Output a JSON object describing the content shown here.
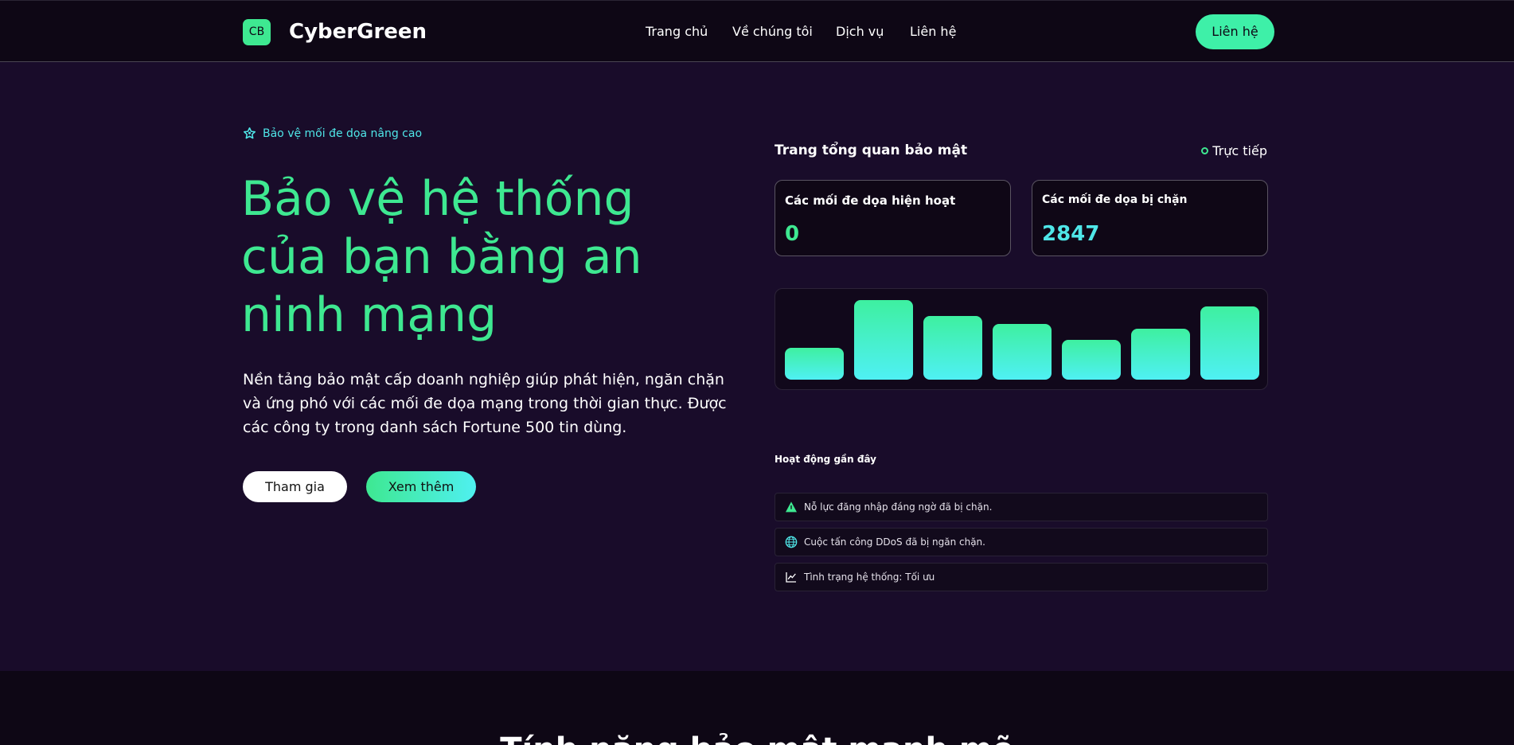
{
  "nav": {
    "logo_text": "CB",
    "brand": "CyberGreen",
    "links": [
      "Trang chủ",
      "Về chúng tôi",
      "Dịch vụ",
      "Liên hệ"
    ],
    "cta": "Liên hệ"
  },
  "hero": {
    "badge": "Bảo vệ mối đe dọa nâng cao",
    "title": "Bảo vệ hệ thống của bạn bằng an ninh mạng",
    "description": "Nền tảng bảo mật cấp doanh nghiệp giúp phát hiện, ngăn chặn và ứng phó với các mối đe dọa mạng trong thời gian thực. Được các công ty trong danh sách Fortune 500 tin dùng.",
    "btn_join": "Tham gia",
    "btn_more": "Xem thêm"
  },
  "dashboard": {
    "title": "Trang tổng quan bảo mật",
    "live": "Trực tiếp",
    "stats": [
      {
        "label": "Các mối đe dọa hiện hoạt",
        "value": "0"
      },
      {
        "label": "Các mối đe dọa bị chặn",
        "value": "2847"
      }
    ],
    "activity_title": "Hoạt động gần đây",
    "activities": [
      {
        "icon": "warning-triangle-icon",
        "text": "Nỗ lực đăng nhập đáng ngờ đã bị chặn."
      },
      {
        "icon": "globe-icon",
        "text": "Cuộc tấn công DDoS đã bị ngăn chặn."
      },
      {
        "icon": "line-chart-icon",
        "text": "Tình trạng hệ thống: Tối ưu"
      }
    ]
  },
  "chart_data": {
    "type": "bar",
    "categories": [
      "",
      "",
      "",
      "",
      "",
      "",
      ""
    ],
    "values": [
      40,
      100,
      80,
      70,
      50,
      64,
      92
    ],
    "ylim": [
      0,
      100
    ],
    "xlabel": "",
    "ylabel": "",
    "grid": false
  },
  "colors": {
    "accent": "#3ee891",
    "accent_cyan": "#4ff0f0",
    "background": "#190c2a",
    "nav_bg": "#0e0715"
  },
  "section2": {
    "heading_partial": "Tính năng bảo mật mạnh mẽ"
  }
}
